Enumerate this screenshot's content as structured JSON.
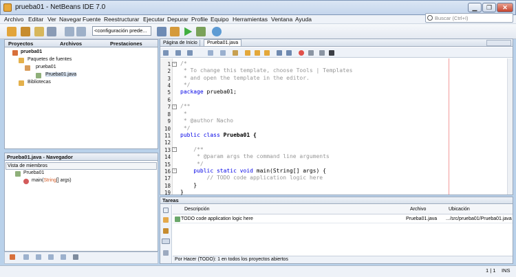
{
  "window": {
    "title": "prueba01 - NetBeans IDE 7.0",
    "min": "▁",
    "max": "❐",
    "close": "✕"
  },
  "menu": [
    "Archivo",
    "Editar",
    "Ver",
    "Navegar",
    "Fuente",
    "Reestructurar",
    "Ejecutar",
    "Depurar",
    "Profile",
    "Equipo",
    "Herramientas",
    "Ventana",
    "Ayuda"
  ],
  "search": {
    "placeholder": "Buscar (Ctrl+I)"
  },
  "toolbar": {
    "config": "<configuración prede..."
  },
  "left_tabs": {
    "projects": "Proyectos",
    "files": "Archivos",
    "services": "Prestaciones"
  },
  "project_tree": {
    "root": "prueba01",
    "src": "Paquetes de fuentes",
    "pkg": "prueba01",
    "file": "Prueba01.java",
    "libs": "Bibliotecas"
  },
  "navigator": {
    "title": "Prueba01.java - Navegador",
    "view": "Vista de miembros",
    "cls": "Prueba01",
    "method_name": "main(",
    "method_type": "String",
    "method_rest": "[] args)"
  },
  "editor_tabs": {
    "start": "Página de Inicio",
    "file": "Prueba01.java"
  },
  "code": {
    "line_numbers": [
      "1",
      "2",
      "3",
      "4",
      "5",
      "6",
      "7",
      "8",
      "9",
      "10",
      "11",
      "12",
      "13",
      "14",
      "15",
      "16",
      "17",
      "18",
      "19"
    ],
    "l1": "/*",
    "l2": " * To change this template, choose Tools | Templates",
    "l3": " * and open the template in the editor.",
    "l4": " */",
    "l5_kw": "package",
    "l5_rest": " prueba01;",
    "l7": "/**",
    "l8": " *",
    "l9": " * @author Nacho",
    "l10": " */",
    "l11_kw": "public class",
    "l11_rest": " Prueba01 {",
    "l13": "    /**",
    "l14": "     * @param args the command line arguments",
    "l15": "     */",
    "l16_kw": "    public static void",
    "l16_rest": " main(String[] args) {",
    "l17": "        // TODO code application logic here",
    "l18": "    }",
    "l19": "}"
  },
  "tasks": {
    "title": "Tareas",
    "columns": [
      "Descripción",
      "Archivo",
      "Ubicación"
    ],
    "row": {
      "desc": "TODO code application logic here",
      "file": "Prueba01.java",
      "loc": ".../src/prueba01/Prueba01.java"
    },
    "filter_label": "Por Hacer (TODO):",
    "filter_value": " 1 en todos los proyectos abiertos"
  },
  "status": {
    "position": "1 | 1",
    "mode": "INS"
  }
}
